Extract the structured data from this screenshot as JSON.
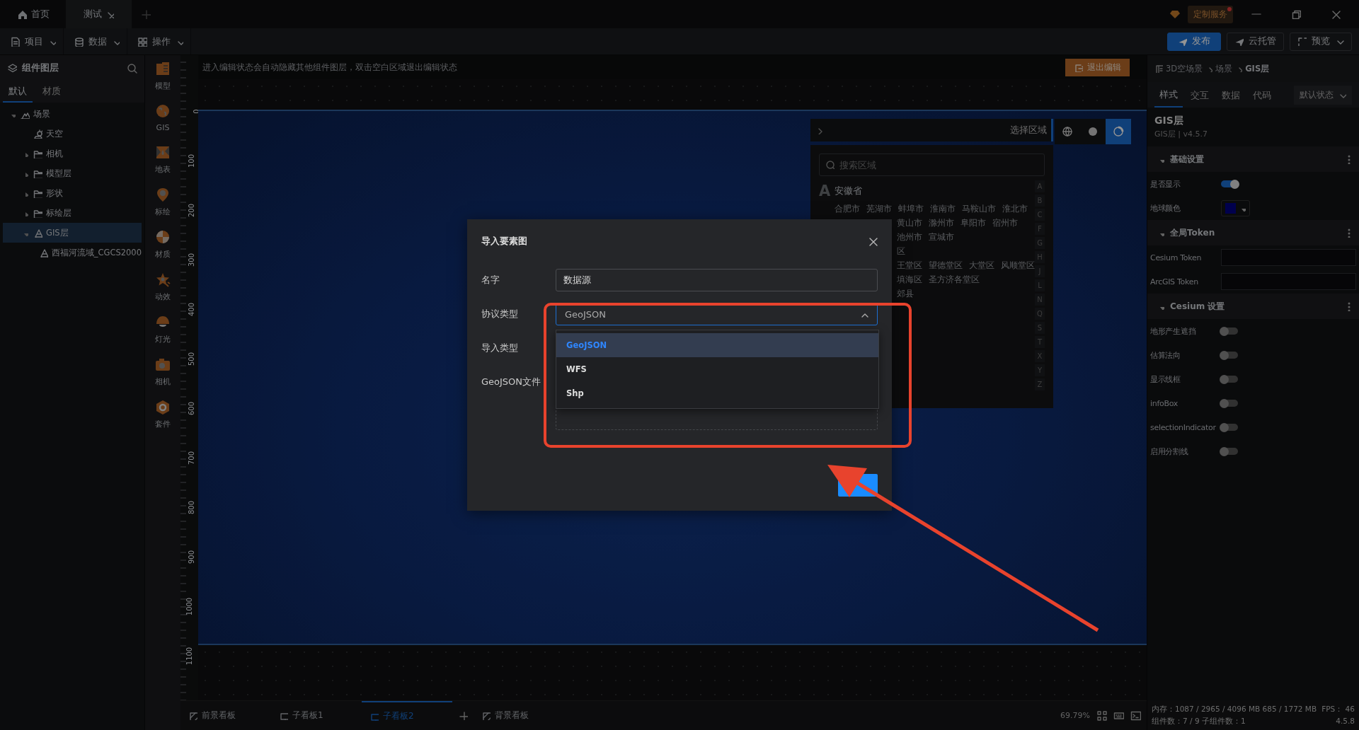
{
  "title_bar": {
    "tabs": [
      {
        "label": "首页",
        "kind": "home",
        "selected": false
      },
      {
        "label": "测试",
        "kind": "doc",
        "selected": true
      }
    ],
    "service": "定制服务",
    "service_alert": true
  },
  "toolbar": {
    "menus": [
      "项目",
      "数据",
      "操作"
    ],
    "buttons": [
      {
        "label": "发布",
        "kind": "primary"
      },
      {
        "label": "云托管",
        "kind": "plain"
      },
      {
        "label": "预览",
        "kind": "split"
      }
    ]
  },
  "layers_panel": {
    "title": "组件图层",
    "tabs": [
      {
        "label": "默认",
        "selected": true
      },
      {
        "label": "材质",
        "selected": false
      }
    ],
    "tree": [
      {
        "label": "场景",
        "kind": "scene",
        "expanded": true,
        "selected": false,
        "children": [
          {
            "label": "天空",
            "kind": "sky",
            "selected": false
          },
          {
            "label": "相机",
            "kind": "folder",
            "expanded": false,
            "selected": false
          },
          {
            "label": "模型层",
            "kind": "folder",
            "expanded": false,
            "selected": false
          },
          {
            "label": "形状",
            "kind": "folder",
            "expanded": false,
            "selected": false
          },
          {
            "label": "标绘层",
            "kind": "folder",
            "expanded": false,
            "selected": false
          },
          {
            "label": "GIS层",
            "kind": "gis",
            "expanded": true,
            "selected": true,
            "children": [
              {
                "label": "西福河流域_CGCS2000",
                "kind": "layer",
                "selected": false
              }
            ]
          }
        ]
      }
    ]
  },
  "component_bar": [
    "模型",
    "GIS",
    "地表",
    "标绘",
    "材质",
    "动效",
    "灯光",
    "相机",
    "套件"
  ],
  "canvas": {
    "notice": "进入编辑状态会自动隐藏其他组件图层，双击空白区域退出编辑状态",
    "exit_button": "退出编辑",
    "ruler_labels": [
      "0",
      "100",
      "200",
      "300",
      "400",
      "500",
      "600",
      "700",
      "800",
      "900",
      "1000",
      "1100"
    ],
    "region_panel": {
      "title": "选择区域",
      "search_placeholder": "搜索区域",
      "letter": "A",
      "province": "安徽省",
      "rows": [
        {
          "covered": false,
          "items": [
            "合肥市",
            "芜湖市",
            "蚌埠市",
            "淮南市",
            "马鞍山市",
            "淮北市"
          ]
        },
        {
          "covered": true,
          "items": [
            "黄山市",
            "滁州市",
            "阜阳市",
            "宿州市"
          ]
        },
        {
          "covered": true,
          "items": [
            "池州市",
            "宣城市"
          ]
        },
        {
          "covered": true,
          "items": [
            "区"
          ]
        },
        {
          "covered": true,
          "items": [
            "王堂区",
            "望德堂区",
            "大堂区",
            "风顺堂区"
          ]
        },
        {
          "covered": true,
          "items": [
            "填海区",
            "圣方济各堂区"
          ]
        },
        {
          "covered": true,
          "items": [
            "郊县"
          ]
        }
      ],
      "index": [
        "A",
        "B",
        "C",
        "F",
        "G",
        "H",
        "J",
        "L",
        "N",
        "Q",
        "S",
        "T",
        "X",
        "Y",
        "Z"
      ]
    },
    "view_buttons": [
      {
        "kind": "globe",
        "selected": false
      },
      {
        "kind": "dot",
        "selected": false
      },
      {
        "kind": "ring",
        "selected": true
      }
    ]
  },
  "dialog": {
    "title": "导入要素图",
    "fields": [
      {
        "label": "名字",
        "kind": "input",
        "value": "数据源"
      },
      {
        "label": "协议类型",
        "kind": "select",
        "value": "GeoJSON",
        "expanded": true
      },
      {
        "label": "导入类型",
        "kind": "hidden"
      },
      {
        "label": "GeoJSON文件",
        "kind": "upload"
      }
    ],
    "options": [
      {
        "label": "GeoJSON",
        "selected": true
      },
      {
        "label": "WFS",
        "selected": false
      },
      {
        "label": "Shp",
        "selected": false
      }
    ]
  },
  "board_tabs": [
    {
      "label": "前景看板",
      "kind": "board",
      "selected": false
    },
    {
      "label": "子看板1",
      "kind": "sub",
      "selected": false
    },
    {
      "label": "子看板2",
      "kind": "sub",
      "selected": true
    },
    {
      "label": "背景看板",
      "kind": "board",
      "selected": false
    }
  ],
  "zoom": "69.79%",
  "inspector": {
    "breadcrumb": [
      "3D空场景",
      "场景",
      "GIS层"
    ],
    "tabs": [
      {
        "label": "样式",
        "selected": true
      },
      {
        "label": "交互",
        "selected": false
      },
      {
        "label": "数据",
        "selected": false
      },
      {
        "label": "代码",
        "selected": false
      }
    ],
    "state_select": "默认状态",
    "component": "GIS层",
    "version": "GIS层 | v4.5.7",
    "sections": [
      {
        "title": "基础设置",
        "rows": [
          {
            "label": "是否显示",
            "kind": "toggle",
            "on": true
          },
          {
            "label": "地球颜色",
            "kind": "color",
            "color": "#00004d"
          }
        ]
      },
      {
        "title": "全局Token",
        "rows": [
          {
            "label": "Cesium Token",
            "kind": "input"
          },
          {
            "label": "ArcGIS Token",
            "kind": "input"
          }
        ]
      },
      {
        "title": "Cesium 设置",
        "rows": [
          {
            "label": "地形产生遮挡",
            "kind": "toggle",
            "on": false
          },
          {
            "label": "估算法向",
            "kind": "toggle",
            "on": false
          },
          {
            "label": "显示线框",
            "kind": "toggle",
            "on": false
          },
          {
            "label": "infoBox",
            "kind": "toggle",
            "on": false
          },
          {
            "label": "selectionIndicator",
            "kind": "toggle",
            "on": false
          },
          {
            "label": "启用分割线",
            "kind": "toggle",
            "on": false
          }
        ]
      }
    ]
  },
  "stats": {
    "memory": "内存：1087 / 2965 / 4096 MB  685 / 1772 MB",
    "fps": "FPS： 46",
    "components": "组件数：7 / 9   子组件数：1",
    "version": "4.5.8"
  }
}
